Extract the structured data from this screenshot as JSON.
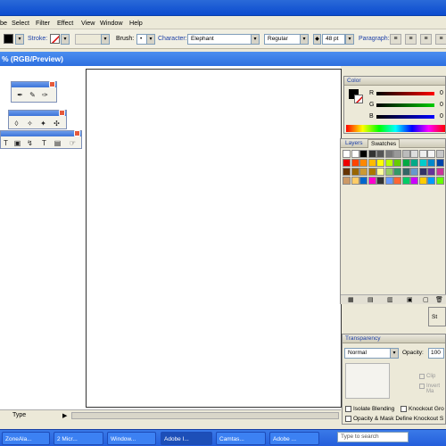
{
  "menu": [
    "be",
    "Select",
    "Filter",
    "Effect",
    "View",
    "Window",
    "Help"
  ],
  "control": {
    "stroke_label": "Stroke:",
    "brush_label": "Brush:",
    "brush_value": "•",
    "character_label": "Character:",
    "font_family": "Elephant",
    "font_style": "Regular",
    "font_size": "48 pt",
    "paragraph_label": "Paragraph:"
  },
  "document": {
    "title": "% (RGB/Preview)"
  },
  "color_panel": {
    "title": "Color",
    "channels": [
      "R",
      "G",
      "B"
    ],
    "values": [
      "0",
      "0",
      "0"
    ]
  },
  "swatches_panel": {
    "tabs": [
      "Layers",
      "Swatches"
    ]
  },
  "stroke_stub": {
    "label": "St"
  },
  "transparency": {
    "title": "Transparency",
    "blend_mode": "Normal",
    "opacity_label": "Opacity:",
    "opacity_value": "100",
    "clip_label": "Clip",
    "invert_label": "Invert Ma",
    "isolate_label": "Isolate Blending",
    "knockout_label": "Knockout Gro",
    "opacity_mask_label": "Opacity & Mask Define Knockout S"
  },
  "status": {
    "label": "Type"
  },
  "taskbar": {
    "tasks": [
      "ZoneAla...",
      "2 Micr...",
      "Window...",
      "Adobe I...",
      "Camtas...",
      "Adobe ..."
    ],
    "search_placeholder": "Type to search"
  },
  "colors": {
    "titlebar": "#0b4bcf",
    "taskbar": "#245edb",
    "docbar": "#2d6fe0",
    "panel_bg": "#ece9d8"
  }
}
